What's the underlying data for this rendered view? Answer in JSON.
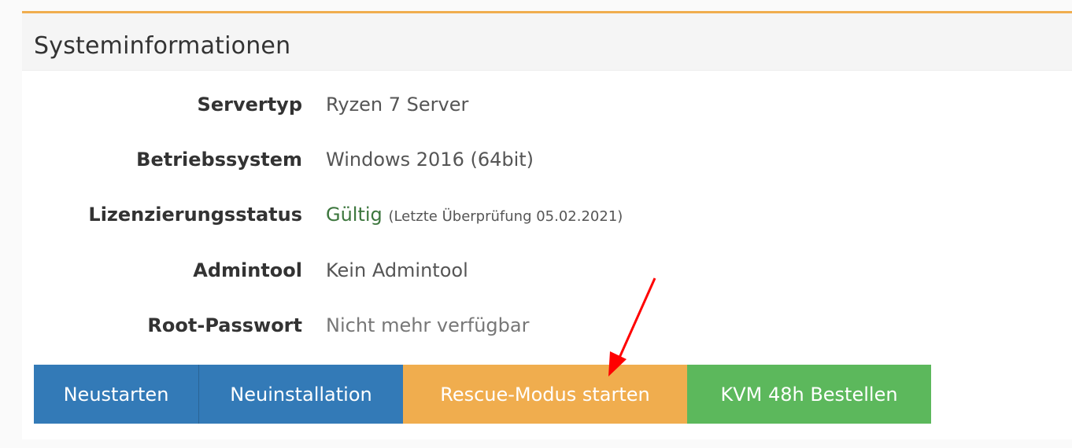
{
  "panel": {
    "title": "Systeminformationen",
    "accent_color": "#f0ad4e"
  },
  "info": {
    "servertyp": {
      "label": "Servertyp",
      "value": "Ryzen 7 Server"
    },
    "betriebssystem": {
      "label": "Betriebssystem",
      "value": "Windows 2016 (64bit)"
    },
    "lizenzierungsstatus": {
      "label": "Lizenzierungsstatus",
      "status": "Gültig",
      "note": "(Letzte Überprüfung 05.02.2021)",
      "status_color": "#3c763d"
    },
    "admintool": {
      "label": "Admintool",
      "value": "Kein Admintool"
    },
    "root_passwort": {
      "label": "Root-Passwort",
      "value": "Nicht mehr verfügbar"
    }
  },
  "actions": {
    "neustarten": {
      "label": "Neustarten",
      "color": "#337ab7"
    },
    "neuinstallation": {
      "label": "Neuinstallation",
      "color": "#337ab7"
    },
    "rescue": {
      "label": "Rescue-Modus starten",
      "color": "#f0ad4e"
    },
    "kvm": {
      "label": "KVM 48h Bestellen",
      "color": "#5cb85c"
    }
  },
  "annotation": {
    "arrow_color": "#ff0000"
  }
}
